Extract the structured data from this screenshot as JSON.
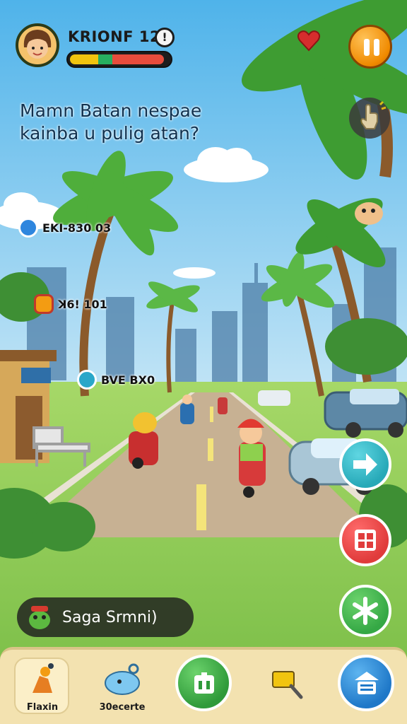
{
  "hud": {
    "player_name": "KRIONF 120",
    "info_label": "!",
    "health_fraction": 0.95
  },
  "question": {
    "line1": "Mamn Batan nespae",
    "line2": "kainba u pulig atan?"
  },
  "tags": [
    {
      "label": "EKI-830 03",
      "icon": "compass-icon"
    },
    {
      "label": "ꓘ6! 101",
      "icon": "robot-icon"
    },
    {
      "label": "BVE BX0",
      "icon": "snowflake-icon"
    }
  ],
  "chip": {
    "label": "Saga Srmni)"
  },
  "nav": [
    {
      "label": "Flaxin",
      "icon": "character-icon"
    },
    {
      "label": "30ecerte",
      "icon": "blob-icon"
    },
    {
      "label": "",
      "icon": "map-icon"
    },
    {
      "label": "",
      "icon": "magnifier-icon"
    },
    {
      "label": "",
      "icon": "shop-icon"
    }
  ],
  "colors": {
    "sky": "#5bb8ea",
    "grass": "#8fcf5a",
    "road": "#bfa98c",
    "pause": "#f08a00",
    "next": "#27a9b8",
    "grid": "#e03b3b",
    "green": "#35a845"
  }
}
